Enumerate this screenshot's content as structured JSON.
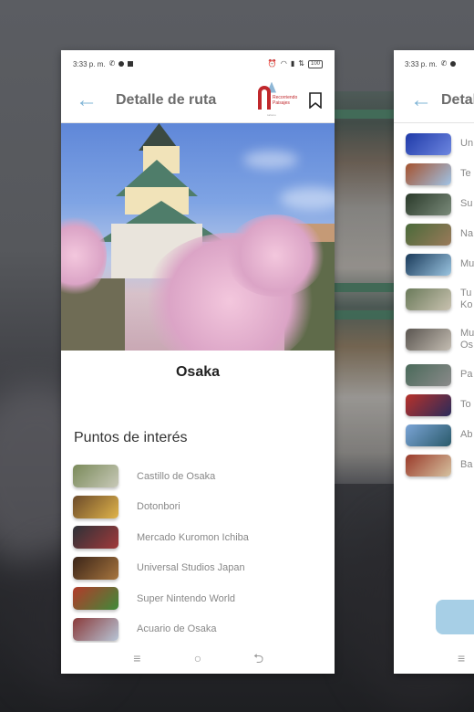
{
  "status_bar": {
    "time": "3:33 p. m.",
    "left_icons": [
      "whatsapp-icon",
      "notification-dot-icon",
      "square-app-icon"
    ],
    "right_icons": [
      "alarm-icon",
      "wifi-icon",
      "signal-icon",
      "lte-icon"
    ],
    "battery": "100"
  },
  "app_bar": {
    "title": "Detalle de ruta",
    "back_icon": "arrow-left-icon",
    "logo_text": "Recorriendo Paisajes",
    "logo_sub": "turismo",
    "bookmark_icon": "bookmark-icon"
  },
  "detail": {
    "place_name": "Osaka",
    "hero_alt": "Osaka Castle with cherry blossoms",
    "section_title": "Puntos de interés",
    "points": [
      {
        "label": "Castillo de Osaka",
        "thumb": [
          "#7a8a5a",
          "#c8c9b8"
        ]
      },
      {
        "label": "Dotonbori",
        "thumb": [
          "#6b4a2a",
          "#e0b44a"
        ]
      },
      {
        "label": "Mercado Kuromon Ichiba",
        "thumb": [
          "#2c3138",
          "#a23a3a"
        ]
      },
      {
        "label": "Universal Studios Japan",
        "thumb": [
          "#3a2418",
          "#a7753e"
        ]
      },
      {
        "label": "Super Nintendo World",
        "thumb": [
          "#b33a2a",
          "#3f8a3a"
        ]
      },
      {
        "label": "Acuario de Osaka",
        "thumb": [
          "#8a3a3a",
          "#b7c5d6"
        ]
      }
    ]
  },
  "right_card": {
    "time": "3:33 p. m.",
    "title": "Detalle de ruta",
    "points": [
      {
        "label": "Umeda Sky Building",
        "visible": "Un",
        "thumb": [
          "#1f3aa8",
          "#6d86e0"
        ]
      },
      {
        "label": "Templo",
        "visible": "Te",
        "thumb": [
          "#a5522e",
          "#9fc3e6"
        ]
      },
      {
        "label": "Santuario Sumiyoshi",
        "visible": "Su",
        "thumb": [
          "#2a3a2a",
          "#7a8a7a"
        ]
      },
      {
        "label": "Nakanoshima",
        "visible": "Na",
        "thumb": [
          "#4a6a3a",
          "#9a7a5a"
        ]
      },
      {
        "label": "Museo",
        "visible": "Mu",
        "thumb": [
          "#1a3a5a",
          "#9ac4e0"
        ]
      },
      {
        "label": "Tumba Ko...",
        "visible": "Tu\nKo",
        "thumb": [
          "#6a7a5a",
          "#c9c2b0"
        ]
      },
      {
        "label": "Museo Os...",
        "visible": "Mu\nOs",
        "thumb": [
          "#5a5550",
          "#c4bdb2"
        ]
      },
      {
        "label": "Parque",
        "visible": "Pa",
        "thumb": [
          "#4a6a5a",
          "#8a8a8a"
        ]
      },
      {
        "label": "Torre",
        "visible": "To",
        "thumb": [
          "#b8322a",
          "#2a2a5a"
        ]
      },
      {
        "label": "Abeno Harukas",
        "visible": "Ab",
        "thumb": [
          "#7aa4d6",
          "#2a5a6a"
        ]
      },
      {
        "label": "Barrio",
        "visible": "Ba",
        "thumb": [
          "#9a3a2a",
          "#d6c2a0"
        ]
      }
    ]
  },
  "nav_bar": {
    "menu_icon": "≡",
    "home_icon": "○",
    "back_icon": "⮌"
  },
  "colors": {
    "accent": "#7fb4d6",
    "logo_red": "#c0282c",
    "button_blue": "#a7cfe6"
  }
}
